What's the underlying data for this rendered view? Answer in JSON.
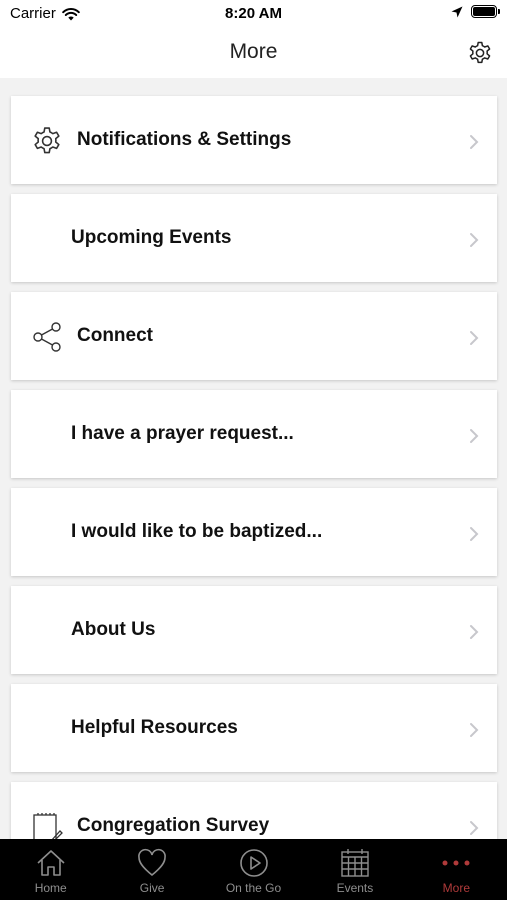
{
  "status": {
    "carrier": "Carrier",
    "time": "8:20 AM"
  },
  "nav": {
    "title": "More"
  },
  "items": [
    {
      "label": "Notifications & Settings",
      "icon": "gear-icon"
    },
    {
      "label": "Upcoming Events",
      "icon": ""
    },
    {
      "label": "Connect",
      "icon": "share-icon"
    },
    {
      "label": "I have a prayer request...",
      "icon": ""
    },
    {
      "label": "I would like to be baptized...",
      "icon": ""
    },
    {
      "label": "About Us",
      "icon": ""
    },
    {
      "label": "Helpful Resources",
      "icon": ""
    },
    {
      "label": "Congregation Survey",
      "icon": "notepad-icon"
    }
  ],
  "tabs": [
    {
      "label": "Home",
      "icon": "home-icon"
    },
    {
      "label": "Give",
      "icon": "heart-icon"
    },
    {
      "label": "On the Go",
      "icon": "play-icon"
    },
    {
      "label": "Events",
      "icon": "calendar-icon"
    },
    {
      "label": "More",
      "icon": "more-dots-icon"
    }
  ],
  "colors": {
    "active_tab": "#b03a3a",
    "inactive_tab": "#8e8e8e",
    "tab_bar_bg": "#000000",
    "page_bg": "#f2f2f2"
  }
}
